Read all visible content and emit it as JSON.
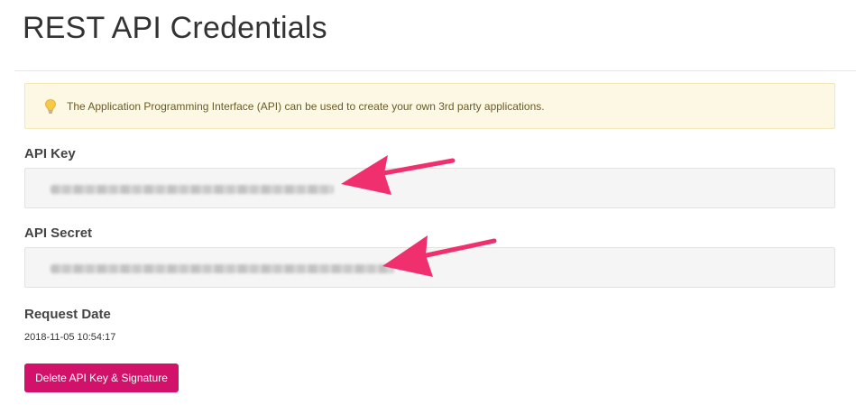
{
  "page": {
    "title": "REST API Credentials"
  },
  "alert": {
    "icon": "lightbulb-icon",
    "text": "The Application Programming Interface (API) can be used to create your own 3rd party applications."
  },
  "fields": {
    "api_key": {
      "label": "API Key"
    },
    "api_secret": {
      "label": "API Secret"
    },
    "request_date": {
      "label": "Request Date",
      "value": "2018-11-05 10:54:17"
    }
  },
  "actions": {
    "delete_label": "Delete API Key & Signature"
  },
  "annotations": {
    "arrow_color": "#f0306e"
  },
  "colors": {
    "accent": "#d1116a",
    "alert_bg": "#fcf8e3"
  }
}
